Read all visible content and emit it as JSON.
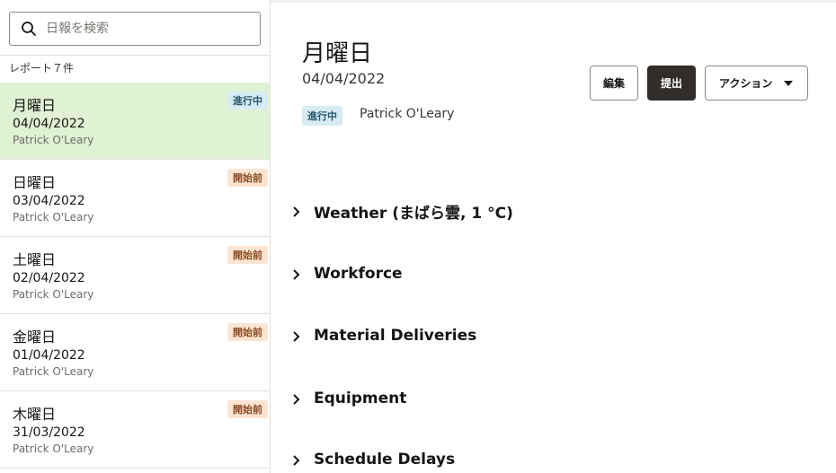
{
  "search": {
    "placeholder": "日報を検索"
  },
  "sidebar": {
    "count_label": "レポート７件",
    "items": [
      {
        "day": "月曜日",
        "date": "04/04/2022",
        "author": "Patrick O'Leary",
        "badge": "進行中",
        "active": true
      },
      {
        "day": "日曜日",
        "date": "03/04/2022",
        "author": "Patrick O'Leary",
        "badge": "開始前",
        "active": false
      },
      {
        "day": "土曜日",
        "date": "02/04/2022",
        "author": "Patrick O'Leary",
        "badge": "開始前",
        "active": false
      },
      {
        "day": "金曜日",
        "date": "01/04/2022",
        "author": "Patrick O'Leary",
        "badge": "開始前",
        "active": false
      },
      {
        "day": "木曜日",
        "date": "31/03/2022",
        "author": "Patrick O'Leary",
        "badge": "開始前",
        "active": false
      }
    ]
  },
  "detail": {
    "title": "月曜日",
    "date": "04/04/2022",
    "status": "進行中",
    "author": "Patrick O'Leary",
    "buttons": {
      "edit": "編集",
      "submit": "提出",
      "actions": "アクション"
    },
    "sections": [
      "Weather (まばら雲, 1 °C)",
      "Workforce",
      "Material Deliveries",
      "Equipment",
      "Schedule Delays"
    ]
  },
  "icons": {
    "search": "search-icon",
    "chevron": "chevron-right-icon",
    "caret": "caret-down-icon"
  },
  "colors": {
    "active_bg": "#dff2d4",
    "progress_badge": "#d6ecf2",
    "notstarted_badge": "#fbe4d2",
    "primary_button": "#312d2a"
  }
}
